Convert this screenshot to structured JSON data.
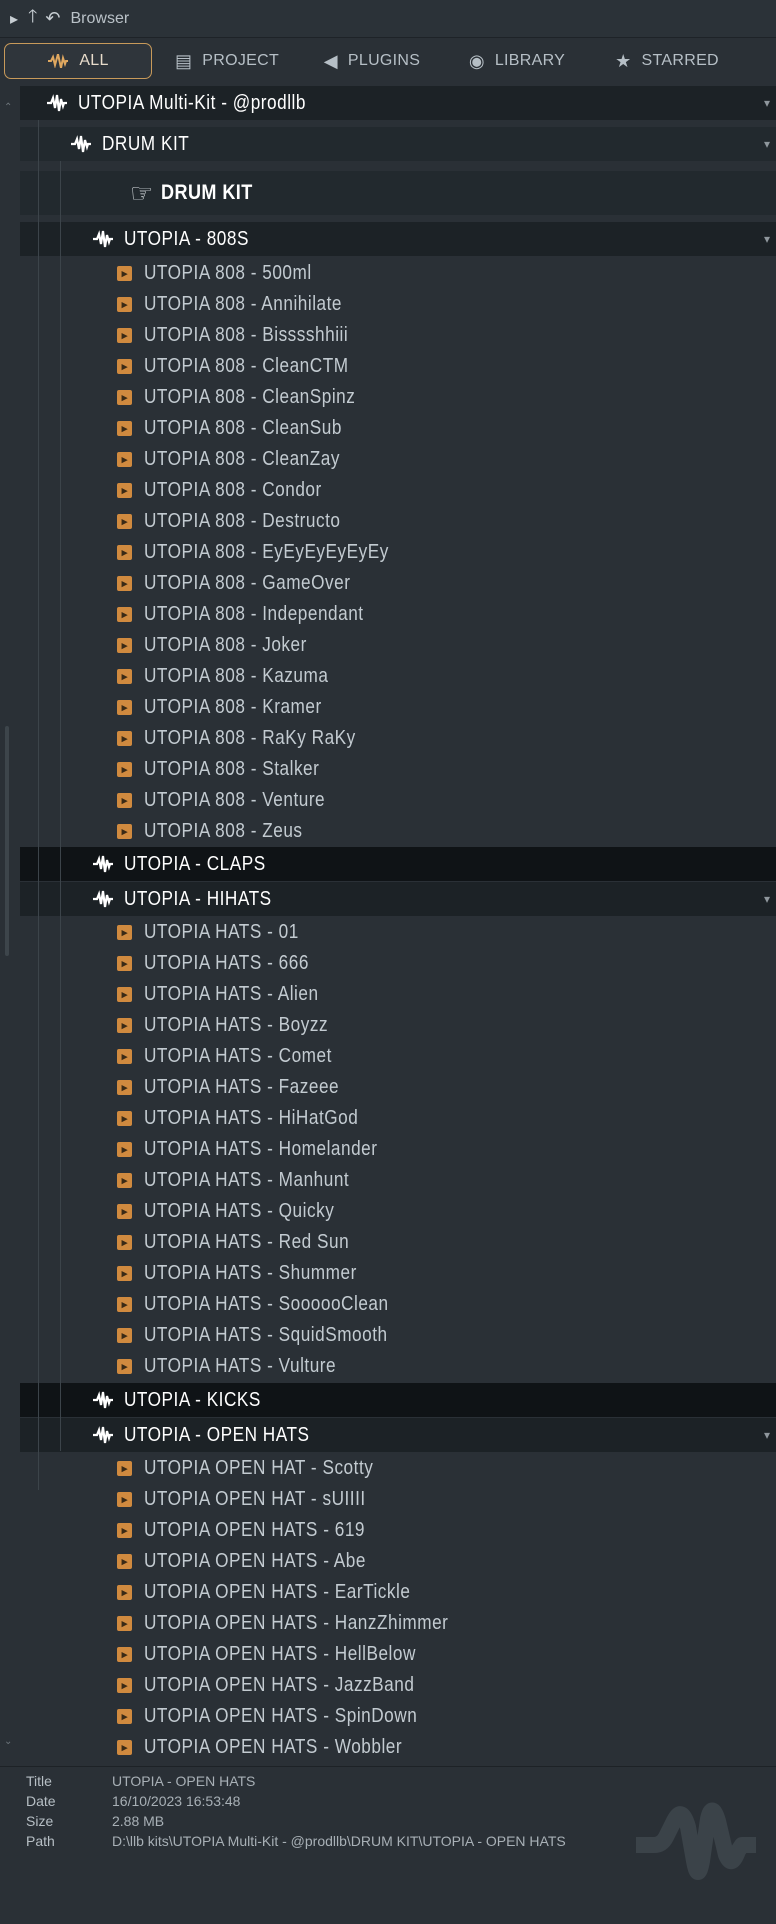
{
  "window": {
    "title": "Browser"
  },
  "tabs": [
    {
      "label": "ALL",
      "icon": "waveform-icon",
      "active": true
    },
    {
      "label": "PROJECT",
      "icon": "document-icon",
      "active": false
    },
    {
      "label": "PLUGINS",
      "icon": "plug-icon",
      "active": false
    },
    {
      "label": "LIBRARY",
      "icon": "globe-icon",
      "active": false
    },
    {
      "label": "STARRED",
      "icon": "star-icon",
      "active": false
    }
  ],
  "tree": {
    "root": "UTOPIA Multi-Kit - @prodllb",
    "drum_kit": "DRUM KIT",
    "drum_kit_hint": "DRUM KIT",
    "folders": {
      "f808": "UTOPIA - 808S",
      "claps": "UTOPIA - CLAPS",
      "hihats": "UTOPIA - HIHATS",
      "kicks": "UTOPIA - KICKS",
      "openhats": "UTOPIA - OPEN HATS"
    },
    "files_808": [
      "UTOPIA 808 - 500ml",
      "UTOPIA 808 - Annihilate",
      "UTOPIA 808 - Bisssshhiii",
      "UTOPIA 808 - CleanCTM",
      "UTOPIA 808 - CleanSpinz",
      "UTOPIA 808 - CleanSub",
      "UTOPIA 808 - CleanZay",
      "UTOPIA 808 - Condor",
      "UTOPIA 808 - Destructo",
      "UTOPIA 808 - EyEyEyEyEyEy",
      "UTOPIA 808 - GameOver",
      "UTOPIA 808 - Independant",
      "UTOPIA 808 - Joker",
      "UTOPIA 808 - Kazuma",
      "UTOPIA 808 - Kramer",
      "UTOPIA 808 - RaKy RaKy",
      "UTOPIA 808 - Stalker",
      "UTOPIA 808 - Venture",
      "UTOPIA 808 - Zeus"
    ],
    "files_hihats": [
      "UTOPIA HATS - 01",
      "UTOPIA HATS - 666",
      "UTOPIA HATS - Alien",
      "UTOPIA HATS - Boyzz",
      "UTOPIA HATS - Comet",
      "UTOPIA HATS - Fazeee",
      "UTOPIA HATS - HiHatGod",
      "UTOPIA HATS - Homelander",
      "UTOPIA HATS - Manhunt",
      "UTOPIA HATS - Quicky",
      "UTOPIA HATS - Red Sun",
      "UTOPIA HATS - Shummer",
      "UTOPIA HATS - SoooooClean",
      "UTOPIA HATS - SquidSmooth",
      "UTOPIA HATS - Vulture"
    ],
    "files_openhats": [
      "UTOPIA OPEN HAT - Scotty",
      "UTOPIA OPEN HAT - sUIIII",
      "UTOPIA OPEN HATS - 619",
      "UTOPIA OPEN HATS - Abe",
      "UTOPIA OPEN HATS - EarTickle",
      "UTOPIA OPEN HATS - HanzZhimmer",
      "UTOPIA OPEN HATS - HellBelow",
      "UTOPIA OPEN HATS - JazzBand",
      "UTOPIA OPEN HATS - SpinDown",
      "UTOPIA OPEN HATS - Wobbler"
    ]
  },
  "info": {
    "title_label": "Title",
    "title_value": "UTOPIA - OPEN HATS",
    "date_label": "Date",
    "date_value": "16/10/2023 16:53:48",
    "size_label": "Size",
    "size_value": "2.88 MB",
    "path_label": "Path",
    "path_value": "D:\\llb kits\\UTOPIA Multi-Kit - @prodllb\\DRUM KIT\\UTOPIA - OPEN HATS"
  },
  "colors": {
    "accent": "#d08a3f",
    "background": "#2a3036",
    "tab_border": "#c89a5a"
  }
}
